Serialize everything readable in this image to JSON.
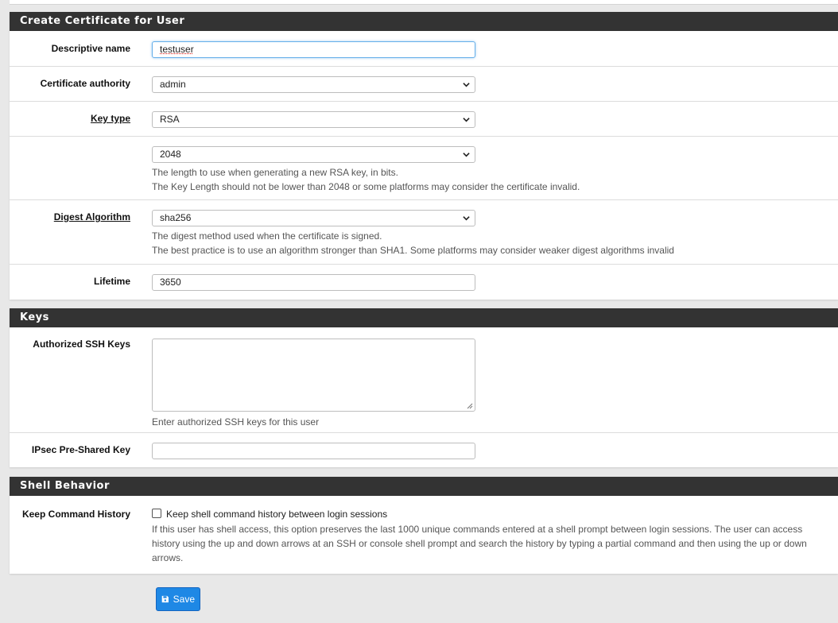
{
  "create_cert": {
    "heading": "Create Certificate for User",
    "descriptive_name": {
      "label": "Descriptive name",
      "value": "testuser"
    },
    "certificate_authority": {
      "label": "Certificate authority",
      "value": "admin"
    },
    "key_type": {
      "label": "Key type",
      "value": "RSA"
    },
    "key_length": {
      "value": "2048",
      "help1": "The length to use when generating a new RSA key, in bits.",
      "help2": "The Key Length should not be lower than 2048 or some platforms may consider the certificate invalid."
    },
    "digest": {
      "label": "Digest Algorithm",
      "value": "sha256",
      "help1": "The digest method used when the certificate is signed.",
      "help2": "The best practice is to use an algorithm stronger than SHA1. Some platforms may consider weaker digest algorithms invalid"
    },
    "lifetime": {
      "label": "Lifetime",
      "value": "3650"
    }
  },
  "keys": {
    "heading": "Keys",
    "ssh": {
      "label": "Authorized SSH Keys",
      "help": "Enter authorized SSH keys for this user"
    },
    "ipsec": {
      "label": "IPsec Pre-Shared Key",
      "value": ""
    }
  },
  "shell": {
    "heading": "Shell Behavior",
    "history": {
      "label": "Keep Command History",
      "checkbox_label": "Keep shell command history between login sessions",
      "checked": false,
      "help": "If this user has shell access, this option preserves the last 1000 unique commands entered at a shell prompt between login sessions. The user can access history using the up and down arrows at an SSH or console shell prompt and search the history by typing a partial command and then using the up or down arrows."
    }
  },
  "save_label": "Save",
  "icons": {
    "select_arrow": "chevron-down-icon",
    "save": "floppy-disk-icon"
  },
  "colors": {
    "heading_bg": "#333333",
    "primary": "#1e88e5"
  }
}
